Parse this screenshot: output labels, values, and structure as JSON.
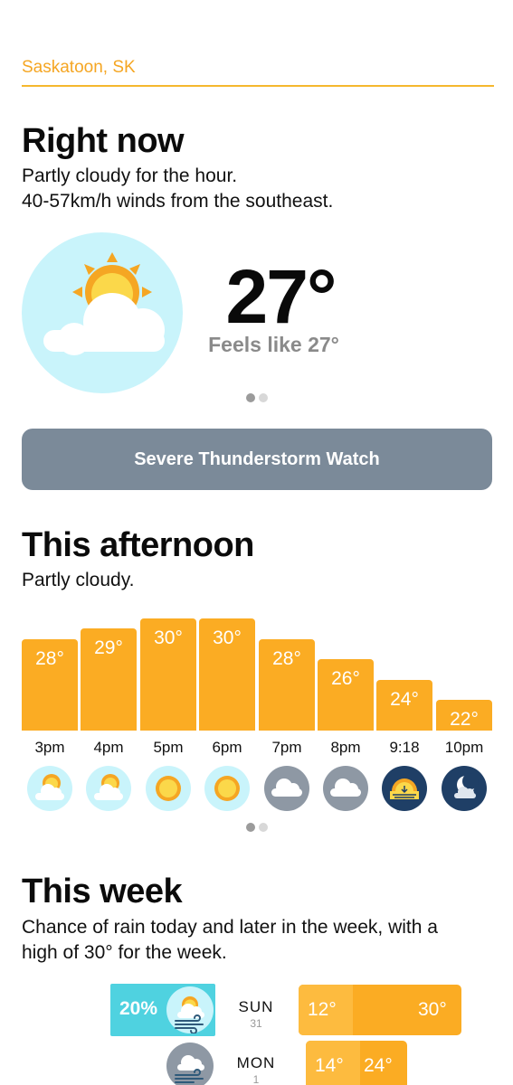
{
  "location": "Saskatoon, SK",
  "right_now": {
    "title": "Right now",
    "summary_line1": "Partly cloudy for the hour.",
    "summary_line2": "40-57km/h winds from the southeast.",
    "temperature": "27°",
    "feels_like": "Feels like 27°",
    "icon": "partly-cloudy-day-icon"
  },
  "alert": {
    "label": "Severe Thunderstorm Watch"
  },
  "afternoon": {
    "title": "This afternoon",
    "summary": "Partly cloudy.",
    "hours": [
      {
        "time": "3pm",
        "temp": "28°",
        "value": 28,
        "icon": "partly-cloudy-day-icon"
      },
      {
        "time": "4pm",
        "temp": "29°",
        "value": 29,
        "icon": "partly-cloudy-day-icon"
      },
      {
        "time": "5pm",
        "temp": "30°",
        "value": 30,
        "icon": "sun-icon"
      },
      {
        "time": "6pm",
        "temp": "30°",
        "value": 30,
        "icon": "sun-icon"
      },
      {
        "time": "7pm",
        "temp": "28°",
        "value": 28,
        "icon": "cloud-icon"
      },
      {
        "time": "8pm",
        "temp": "26°",
        "value": 26,
        "icon": "cloud-icon"
      },
      {
        "time": "9:18",
        "temp": "24°",
        "value": 24,
        "icon": "sunset-icon"
      },
      {
        "time": "10pm",
        "temp": "22°",
        "value": 22,
        "icon": "night-cloud-icon"
      }
    ]
  },
  "week": {
    "title": "This week",
    "summary_line1": "Chance of rain today and later in the week, with a",
    "summary_line2": "high of 30° for the week.",
    "days": [
      {
        "day": "SUN",
        "date": "31",
        "rain": "20%",
        "low": "12°",
        "high": "30°",
        "low_value": 12,
        "high_value": 30,
        "icon": "partly-cloudy-windy-icon"
      },
      {
        "day": "MON",
        "date": "1",
        "rain": "",
        "low": "14°",
        "high": "24°",
        "low_value": 14,
        "high_value": 24,
        "icon": "cloudy-windy-icon"
      }
    ]
  },
  "colors": {
    "accent_orange": "#fbac23",
    "icon_bg": "#c9f4fb",
    "night_bg": "#1f3f66",
    "cloud_bg": "#8e98a4",
    "alert_bg": "#7b8a99",
    "rain_bg": "#4fd2e0"
  }
}
